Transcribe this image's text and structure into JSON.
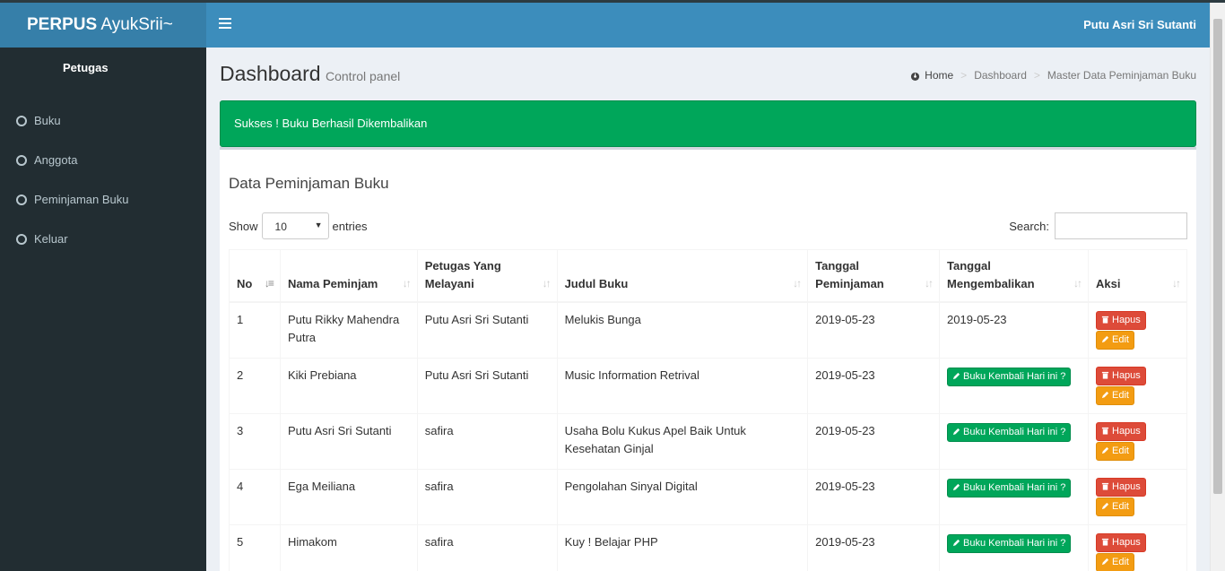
{
  "app": {
    "logo_bold": "PERPUS",
    "logo_rest": " AyukSrii~"
  },
  "navbar": {
    "user": "Putu Asri Sri Sutanti"
  },
  "sidebar": {
    "user": "Petugas",
    "items": [
      {
        "label": "Buku"
      },
      {
        "label": "Anggota"
      },
      {
        "label": "Peminjaman Buku"
      },
      {
        "label": "Keluar"
      }
    ]
  },
  "header": {
    "title": "Dashboard",
    "subtitle": "Control panel"
  },
  "breadcrumb": {
    "home": "Home",
    "b1": "Dashboard",
    "b2": "Master Data Peminjaman Buku",
    "sep": ">"
  },
  "alert": {
    "text": "Sukses ! Buku Berhasil Dikembalikan"
  },
  "box": {
    "title": "Data Peminjaman Buku"
  },
  "length": {
    "show": "Show",
    "value": "10",
    "entries": "entries"
  },
  "search": {
    "label": "Search:"
  },
  "table": {
    "headers": {
      "no": "No",
      "nama": "Nama Peminjam",
      "petugas_1": "Petugas Yang",
      "petugas_2": "Melayani",
      "judul": "Judul Buku",
      "pinjam_1": "Tanggal",
      "pinjam_2": "Peminjaman",
      "kembali_1": "Tanggal",
      "kembali_2": "Mengembalikan",
      "aksi": "Aksi"
    },
    "rows": [
      {
        "no": "1",
        "nama": "Putu Rikky Mahendra Putra",
        "petugas": "Putu Asri Sri Sutanti",
        "judul": "Melukis Bunga",
        "pinjam": "2019-05-23",
        "kembali": "2019-05-23"
      },
      {
        "no": "2",
        "nama": "Kiki Prebiana",
        "petugas": "Putu Asri Sri Sutanti",
        "judul": "Music Information Retrival",
        "pinjam": "2019-05-23",
        "kembali": ""
      },
      {
        "no": "3",
        "nama": "Putu Asri Sri Sutanti",
        "petugas": "safira",
        "judul": "Usaha Bolu Kukus Apel Baik Untuk Kesehatan Ginjal",
        "pinjam": "2019-05-23",
        "kembali": ""
      },
      {
        "no": "4",
        "nama": "Ega Meiliana",
        "petugas": "safira",
        "judul": "Pengolahan Sinyal Digital",
        "pinjam": "2019-05-23",
        "kembali": ""
      },
      {
        "no": "5",
        "nama": "Himakom",
        "petugas": "safira",
        "judul": "Kuy ! Belajar PHP",
        "pinjam": "2019-05-23",
        "kembali": ""
      }
    ],
    "btn_return": "Buku Kembali Hari ini ?",
    "btn_delete": "Hapus",
    "btn_edit": "Edit"
  },
  "icons": [
    "menu-icon",
    "home-icon",
    "trash-icon",
    "pencil-icon",
    "sort-icon",
    "circle-icon"
  ],
  "colors": {
    "navbar": "#3c8dbc",
    "logo": "#367fa9",
    "sidebar": "#222d32",
    "success": "#00a65a",
    "danger": "#dd4b39",
    "warning": "#f39c12"
  }
}
